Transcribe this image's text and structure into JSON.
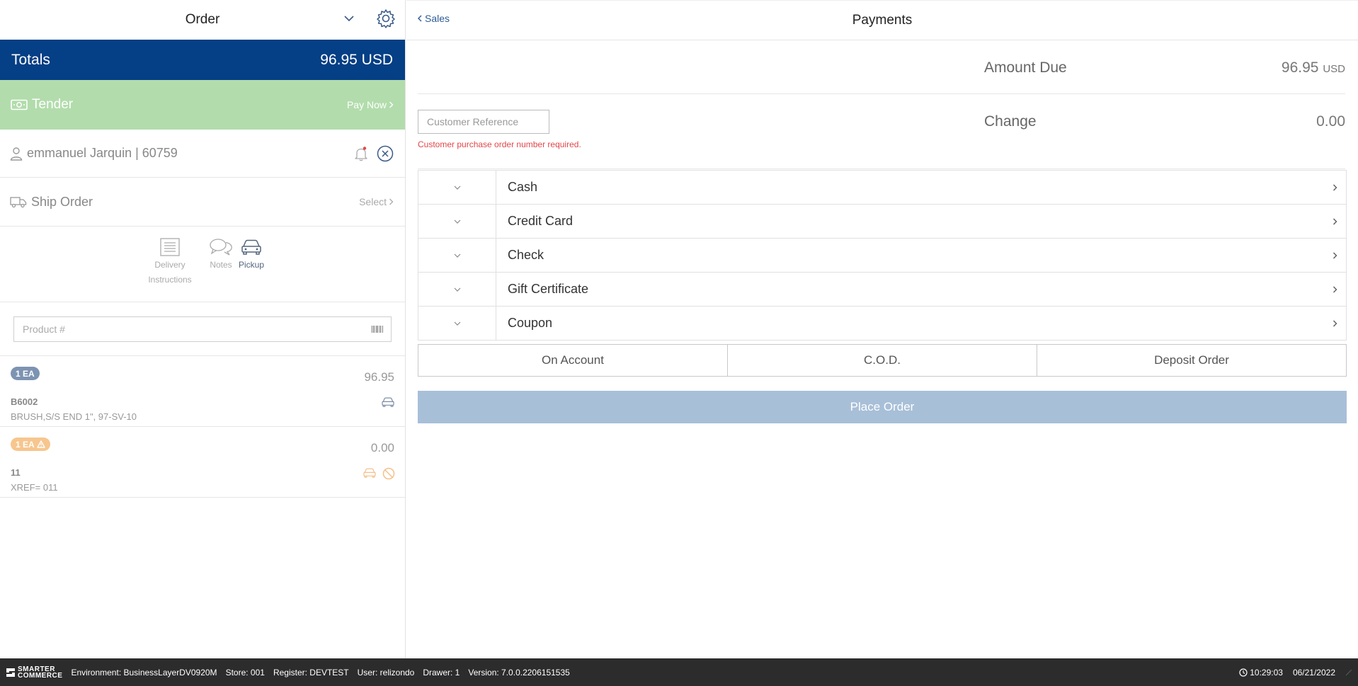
{
  "order_panel": {
    "title": "Order",
    "totals_label": "Totals",
    "totals_value": "96.95 USD",
    "tender_label": "Tender",
    "pay_now_label": "Pay Now",
    "customer_name": "emmanuel Jarquin | 60759",
    "ship_label": "Ship Order",
    "ship_select_label": "Select",
    "ship_options": [
      {
        "label": "Delivery Instructions"
      },
      {
        "label": "Notes"
      },
      {
        "label": "Pickup"
      }
    ],
    "product_placeholder": "Product #",
    "line_items": [
      {
        "qty_badge": "1 EA",
        "price": "96.95",
        "sku": "B6002",
        "description": "BRUSH,S/S END 1\", 97-SV-10"
      },
      {
        "qty_badge": "1 EA",
        "price": "0.00",
        "sku": "11",
        "description": "XREF= 011"
      }
    ]
  },
  "payments": {
    "back_label": "Sales",
    "title": "Payments",
    "amount_due_label": "Amount Due",
    "amount_due_value": "96.95",
    "amount_due_currency": "USD",
    "change_label": "Change",
    "change_value": "0.00",
    "customer_reference_placeholder": "Customer Reference",
    "customer_reference_error": "Customer purchase order number required.",
    "methods": [
      {
        "label": "Cash"
      },
      {
        "label": "Credit Card"
      },
      {
        "label": "Check"
      },
      {
        "label": "Gift Certificate"
      },
      {
        "label": "Coupon"
      }
    ],
    "alt_buttons": [
      {
        "label": "On Account"
      },
      {
        "label": "C.O.D."
      },
      {
        "label": "Deposit Order"
      }
    ],
    "place_order_label": "Place Order"
  },
  "statusbar": {
    "logo_line1": "SMARTER",
    "logo_line2": "COMMERCE",
    "environment": "Environment: BusinessLayerDV0920M",
    "store": "Store: 001",
    "register": "Register: DEVTEST",
    "user": "User: relizondo",
    "drawer": "Drawer: 1",
    "version": "Version: 7.0.0.2206151535",
    "time": "10:29:03",
    "date": "06/21/2022"
  },
  "colors": {
    "totals_bg": "#053f85",
    "tender_bg": "#b2dcac",
    "place_order_bg": "#a8bfd8",
    "error": "#e0464b",
    "statusbar_bg": "#2c2c2c"
  }
}
